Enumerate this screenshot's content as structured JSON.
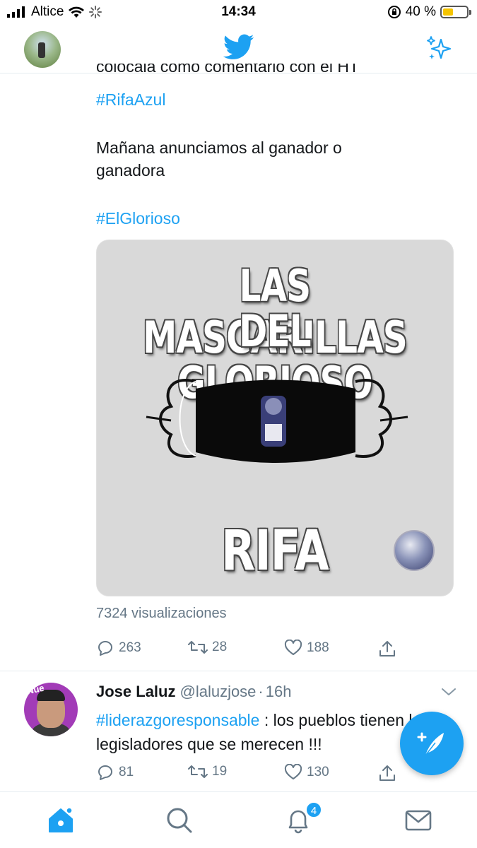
{
  "status_bar": {
    "carrier": "Altice",
    "time": "14:34",
    "battery_text": "40 %",
    "icons": [
      "signal-icon",
      "wifi-icon",
      "activity-spinner-icon",
      "rotation-lock-icon",
      "battery-icon"
    ]
  },
  "top_nav": {
    "icons": [
      "profile-avatar",
      "twitter-bird-icon",
      "sparkle-icon"
    ]
  },
  "tweet1": {
    "partial_line": "colócala como comentario con el HT",
    "hashtag_rifa": "#RifaAzul",
    "line_announce_1": "Mañana anunciamos al ganador o",
    "line_announce_2": "ganadora",
    "hashtag_glorioso": "#ElGlorioso",
    "media": {
      "line1": "LAS MASCARILLAS",
      "line2": "DEL GLORIOSO",
      "line3": "RIFA"
    },
    "views": "7324 visualizaciones",
    "reply_count": "263",
    "retweet_count": "28",
    "like_count": "188"
  },
  "tweet2": {
    "name": "Jose Laluz",
    "handle": "@laluzjose",
    "separator": "·",
    "time": "16h",
    "hashtag": "#liderazgoresponsable",
    "text_rest": " : los pueblos tienen los legisladores que se merecen !!!",
    "reply_count": "81",
    "retweet_count": "19",
    "like_count": "130"
  },
  "tab_bar": {
    "notification_badge": "4",
    "icons": [
      "home-icon",
      "search-icon",
      "bell-icon",
      "mail-icon"
    ]
  },
  "colors": {
    "accent": "#1da1f2",
    "secondary_text": "#657786",
    "battery_fill": "#f5c400"
  }
}
